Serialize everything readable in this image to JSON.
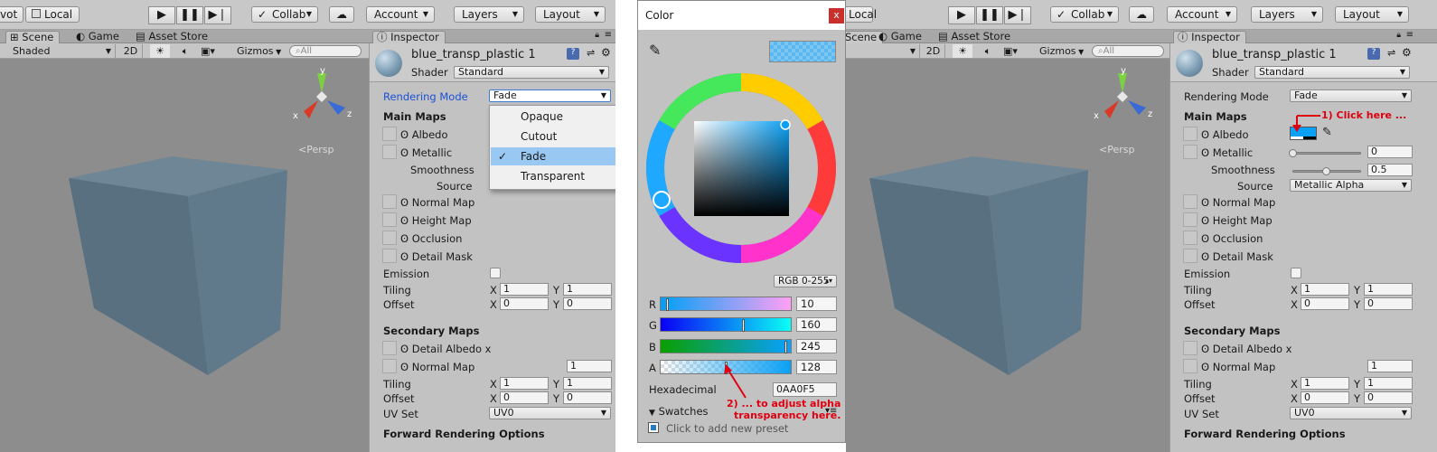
{
  "toolbar": {
    "pivot_label": "vot",
    "local_label": "Local",
    "collab_label": "Collab",
    "account_label": "Account",
    "layers_label": "Layers",
    "layout_label": "Layout"
  },
  "tabs": {
    "scene": "Scene",
    "game": "Game",
    "asset_store": "Asset Store",
    "inspector": "Inspector"
  },
  "scenebar": {
    "shaded": "Shaded",
    "two_d": "2D",
    "gizmos": "Gizmos",
    "search_placeholder": "All",
    "persp": "Persp"
  },
  "material": {
    "name": "blue_transp_plastic 1",
    "shader_label": "Shader",
    "shader_value": "Standard"
  },
  "inspector": {
    "rendering_mode_label": "Rendering Mode",
    "rendering_mode_value": "Fade",
    "main_maps": "Main Maps",
    "albedo": "Albedo",
    "metallic": "Metallic",
    "metallic_value": "0",
    "smoothness": "Smoothness",
    "smoothness_value": "0.5",
    "source": "Source",
    "source_value": "Metallic Alpha",
    "normal_map": "Normal Map",
    "height_map": "Height Map",
    "occlusion": "Occlusion",
    "detail_mask": "Detail Mask",
    "emission": "Emission",
    "tiling": "Tiling",
    "offset": "Offset",
    "x": "X",
    "y": "Y",
    "tiling_x": "1",
    "tiling_y": "1",
    "offset_x": "0",
    "offset_y": "0",
    "secondary_maps": "Secondary Maps",
    "detail_albedo": "Detail Albedo x",
    "secondary_normal_map": "Normal Map",
    "secondary_normal_value": "1",
    "sec_tiling_x": "1",
    "sec_tiling_y": "1",
    "sec_offset_x": "0",
    "sec_offset_y": "0",
    "uv_set": "UV Set",
    "uv_set_value": "UV0",
    "forward_rendering": "Forward Rendering Options"
  },
  "rendering_mode_menu": {
    "options": [
      "Opaque",
      "Cutout",
      "Fade",
      "Transparent"
    ],
    "selected": "Fade"
  },
  "color_picker": {
    "title": "Color",
    "close": "x",
    "mode": "RGB 0-255",
    "r_label": "R",
    "r_value": "10",
    "g_label": "G",
    "g_value": "160",
    "b_label": "B",
    "b_value": "245",
    "a_label": "A",
    "a_value": "128",
    "hex_label": "Hexadecimal",
    "hex_value": "0AA0F5",
    "swatches_label": "Swatches",
    "add_preset": "Click to add new preset"
  },
  "annotations": {
    "step1": "1) Click here ...",
    "step2_line1": "2) ... to adjust alpha",
    "step2_line2": "transparency here."
  },
  "colors": {
    "accent_blue": "#0AA0F5",
    "annotation_red": "#E0000F",
    "panel_gray": "#C2C2C2",
    "scene_gray": "#8D8D8D",
    "cube_blue": "#62798A"
  }
}
